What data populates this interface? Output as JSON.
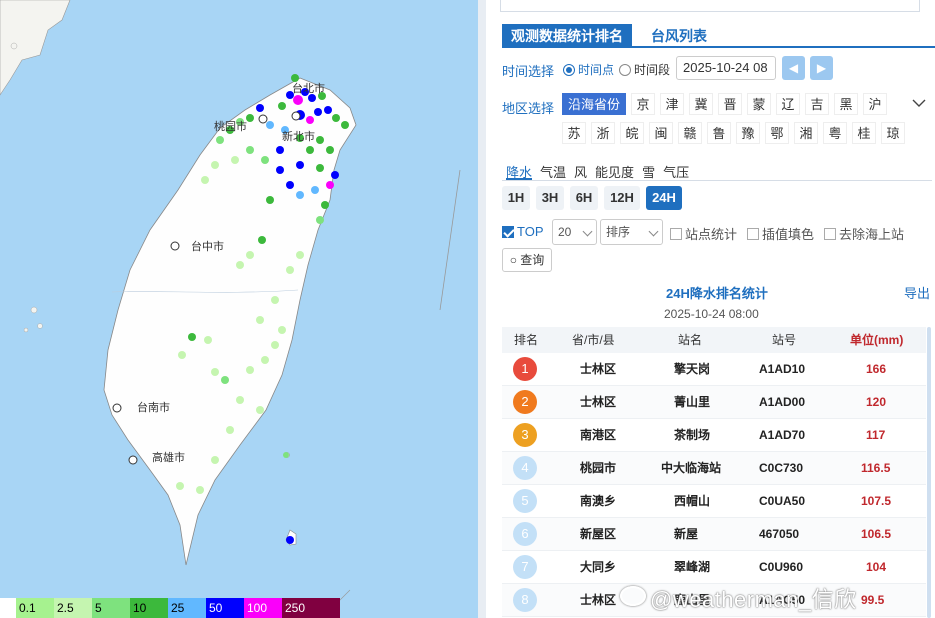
{
  "map": {
    "city_labels": [
      {
        "key": "taipei",
        "text": "台北市"
      },
      {
        "key": "taoyuan",
        "text": "桃园市"
      },
      {
        "key": "newtaipei",
        "text": "新北市"
      },
      {
        "key": "taichung",
        "text": "台中市"
      },
      {
        "key": "tainan",
        "text": "台南市"
      },
      {
        "key": "kaohsiung",
        "text": "高雄市"
      }
    ],
    "legend": [
      {
        "label": "0.1",
        "color": "#a6f28f"
      },
      {
        "label": "2.5",
        "color": "#c5f5b0"
      },
      {
        "label": "5",
        "color": "#7ee27e"
      },
      {
        "label": "10",
        "color": "#3cb93c"
      },
      {
        "label": "25",
        "color": "#61b8ff"
      },
      {
        "label": "50",
        "color": "#0000fe"
      },
      {
        "label": "100",
        "color": "#fa00fa"
      },
      {
        "label": "250",
        "color": "#800040"
      }
    ]
  },
  "panel": {
    "tabs": {
      "active": "观测数据统计排名",
      "inactive": "台风列表"
    },
    "time": {
      "label": "时间选择",
      "opt_point": "时间点",
      "opt_range": "时间段",
      "date": "2025-10-24 08",
      "prev": "◀",
      "next": "▶"
    },
    "region": {
      "label": "地区选择",
      "row1": [
        "沿海省份",
        "京",
        "津",
        "冀",
        "晋",
        "蒙",
        "辽",
        "吉",
        "黑",
        "沪"
      ],
      "row2": [
        "苏",
        "浙",
        "皖",
        "闽",
        "赣",
        "鲁",
        "豫",
        "鄂",
        "湘",
        "粤",
        "桂",
        "琼"
      ]
    },
    "elements": [
      "降水",
      "气温",
      "风",
      "能见度",
      "雪",
      "气压"
    ],
    "hours": [
      "1H",
      "3H",
      "6H",
      "12H",
      "24H"
    ],
    "options": {
      "top_label": "TOP",
      "top_value": "20",
      "sort_label": "排序",
      "cb_station": "站点统计",
      "cb_interp": "插值填色",
      "cb_sea": "去除海上站",
      "query": "查询"
    },
    "stat_title": "24H降水排名统计",
    "stat_date": "2025-10-24 08:00",
    "export": "导出",
    "table": {
      "headers": {
        "rank": "排名",
        "region": "省/市/县",
        "name": "站名",
        "id": "站号",
        "unit": "单位(mm)"
      },
      "rows": [
        {
          "rank": "1",
          "region": "士林区",
          "name": "擎天岗",
          "id": "A1AD10",
          "value": "166",
          "color": "#e84b3c"
        },
        {
          "rank": "2",
          "region": "士林区",
          "name": "菁山里",
          "id": "A1AD00",
          "value": "120",
          "color": "#f07a1e"
        },
        {
          "rank": "3",
          "region": "南港区",
          "name": "茶制场",
          "id": "A1AD70",
          "value": "117",
          "color": "#eda021"
        },
        {
          "rank": "4",
          "region": "桃园市",
          "name": "中大临海站",
          "id": "C0C730",
          "value": "116.5",
          "color": "#c3e0f7"
        },
        {
          "rank": "5",
          "region": "南澳乡",
          "name": "西帽山",
          "id": "C0UA50",
          "value": "107.5",
          "color": "#c3e0f7"
        },
        {
          "rank": "6",
          "region": "新屋区",
          "name": "新屋",
          "id": "467050",
          "value": "106.5",
          "color": "#c3e0f7"
        },
        {
          "rank": "7",
          "region": "大同乡",
          "name": "翠峰湖",
          "id": "C0U960",
          "value": "104",
          "color": "#c3e0f7"
        },
        {
          "rank": "8",
          "region": "士林区",
          "name": "鹿山里",
          "id": "A1AC50",
          "value": "99.5",
          "color": "#c3e0f7"
        }
      ]
    },
    "watermark": "@weatherman_信欣"
  }
}
